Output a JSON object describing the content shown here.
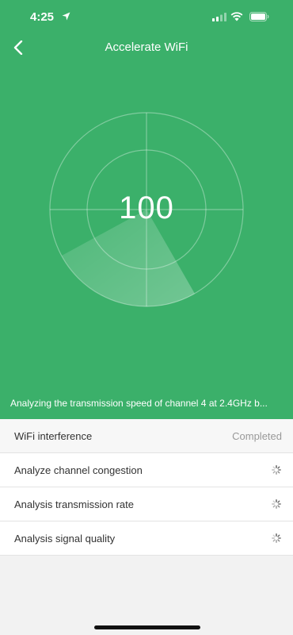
{
  "status_bar": {
    "time": "4:25"
  },
  "nav": {
    "title": "Accelerate WiFi",
    "back_icon": "chevron-left-icon"
  },
  "gauge": {
    "score": "100"
  },
  "status_line": "Analyzing the transmission speed of channel 4 at 2.4GHz b...",
  "checks": [
    {
      "label": "WiFi interference",
      "status": "Completed"
    },
    {
      "label": "Analyze channel congestion",
      "status_icon": "spinner-icon"
    },
    {
      "label": "Analysis transmission rate",
      "status_icon": "spinner-icon"
    },
    {
      "label": "Analysis signal quality",
      "status_icon": "spinner-icon"
    }
  ],
  "colors": {
    "accent": "#3bb06a",
    "background": "#f2f2f2"
  }
}
